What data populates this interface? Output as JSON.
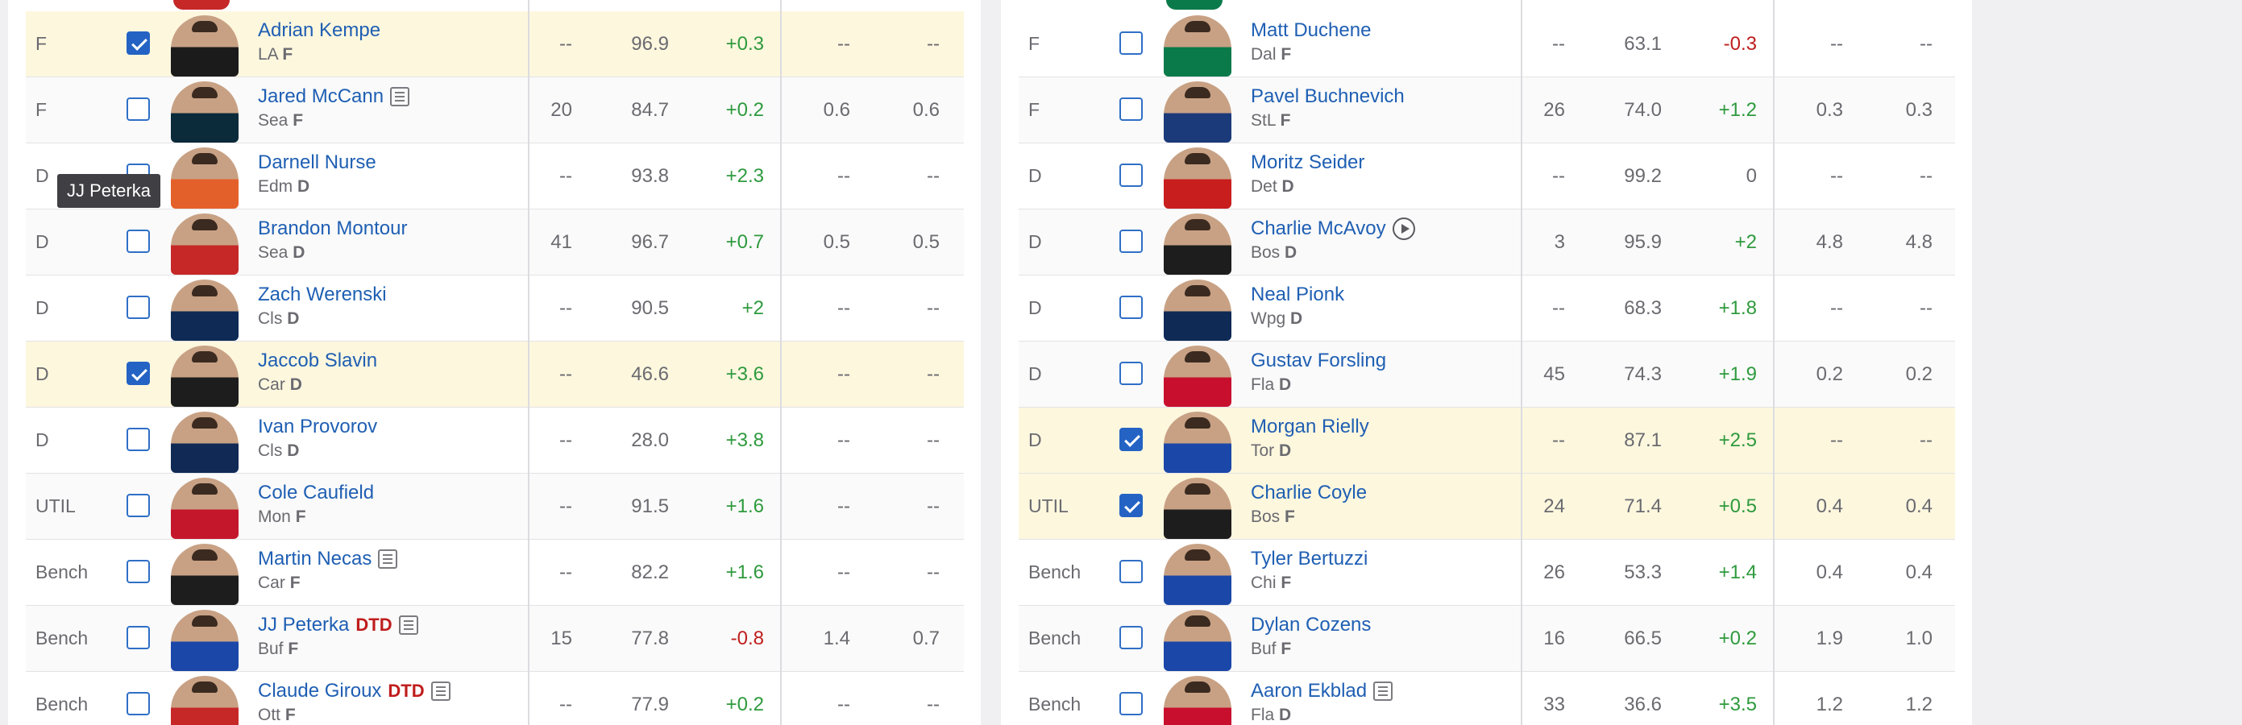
{
  "tooltip": "JJ Peterka",
  "left": {
    "rows": [
      {
        "pos": "F",
        "checked": true,
        "name": "Adrian Kempe",
        "team": "LA",
        "elig": "F",
        "dtd": "",
        "icon": "",
        "c1": "--",
        "c2": "96.9",
        "c3": "+0.3",
        "c4": "--",
        "c5": "--",
        "jersey": "#1b1b1b"
      },
      {
        "pos": "F",
        "checked": false,
        "name": "Jared McCann",
        "team": "Sea",
        "elig": "F",
        "dtd": "",
        "icon": "news-icon",
        "c1": "20",
        "c2": "84.7",
        "c3": "+0.2",
        "c4": "0.6",
        "c5": "0.6",
        "jersey": "#0b2a3a"
      },
      {
        "pos": "D",
        "checked": false,
        "name": "Darnell Nurse",
        "team": "Edm",
        "elig": "D",
        "dtd": "",
        "icon": "",
        "c1": "--",
        "c2": "93.8",
        "c3": "+2.3",
        "c4": "--",
        "c5": "--",
        "jersey": "#e4602a"
      },
      {
        "pos": "D",
        "checked": false,
        "name": "Brandon Montour",
        "team": "Sea",
        "elig": "D",
        "dtd": "",
        "icon": "",
        "c1": "41",
        "c2": "96.7",
        "c3": "+0.7",
        "c4": "0.5",
        "c5": "0.5",
        "jersey": "#c62828"
      },
      {
        "pos": "D",
        "checked": false,
        "name": "Zach Werenski",
        "team": "Cls",
        "elig": "D",
        "dtd": "",
        "icon": "",
        "c1": "--",
        "c2": "90.5",
        "c3": "+2",
        "c4": "--",
        "c5": "--",
        "jersey": "#0e2a55"
      },
      {
        "pos": "D",
        "checked": true,
        "name": "Jaccob Slavin",
        "team": "Car",
        "elig": "D",
        "dtd": "",
        "icon": "",
        "c1": "--",
        "c2": "46.6",
        "c3": "+3.6",
        "c4": "--",
        "c5": "--",
        "jersey": "#1d1d1d"
      },
      {
        "pos": "D",
        "checked": false,
        "name": "Ivan Provorov",
        "team": "Cls",
        "elig": "D",
        "dtd": "",
        "icon": "",
        "c1": "--",
        "c2": "28.0",
        "c3": "+3.8",
        "c4": "--",
        "c5": "--",
        "jersey": "#102a55"
      },
      {
        "pos": "UTIL",
        "checked": false,
        "name": "Cole Caufield",
        "team": "Mon",
        "elig": "F",
        "dtd": "",
        "icon": "",
        "c1": "--",
        "c2": "91.5",
        "c3": "+1.6",
        "c4": "--",
        "c5": "--",
        "jersey": "#c4172c"
      },
      {
        "pos": "Bench",
        "checked": false,
        "name": "Martin Necas",
        "team": "Car",
        "elig": "F",
        "dtd": "",
        "icon": "news-icon",
        "c1": "--",
        "c2": "82.2",
        "c3": "+1.6",
        "c4": "--",
        "c5": "--",
        "jersey": "#1d1d1d"
      },
      {
        "pos": "Bench",
        "checked": false,
        "name": "JJ Peterka",
        "team": "Buf",
        "elig": "F",
        "dtd": "DTD",
        "icon": "news-icon",
        "c1": "15",
        "c2": "77.8",
        "c3": "-0.8",
        "c4": "1.4",
        "c5": "0.7",
        "jersey": "#1a47a8"
      },
      {
        "pos": "Bench",
        "checked": false,
        "name": "Claude Giroux",
        "team": "Ott",
        "elig": "F",
        "dtd": "DTD",
        "icon": "news-icon",
        "c1": "--",
        "c2": "77.9",
        "c3": "+0.2",
        "c4": "--",
        "c5": "--",
        "jersey": "#c62828"
      }
    ]
  },
  "right": {
    "rows": [
      {
        "pos": "F",
        "checked": false,
        "name": "Matt Duchene",
        "team": "Dal",
        "elig": "F",
        "dtd": "",
        "icon": "",
        "c1": "--",
        "c2": "63.1",
        "c3": "-0.3",
        "c4": "--",
        "c5": "--",
        "jersey": "#0a7a4a"
      },
      {
        "pos": "F",
        "checked": false,
        "name": "Pavel Buchnevich",
        "team": "StL",
        "elig": "F",
        "dtd": "",
        "icon": "",
        "c1": "26",
        "c2": "74.0",
        "c3": "+1.2",
        "c4": "0.3",
        "c5": "0.3",
        "jersey": "#1b3a7a"
      },
      {
        "pos": "D",
        "checked": false,
        "name": "Moritz Seider",
        "team": "Det",
        "elig": "D",
        "dtd": "",
        "icon": "",
        "c1": "--",
        "c2": "99.2",
        "c3": "0",
        "c4": "--",
        "c5": "--",
        "jersey": "#c81e1e"
      },
      {
        "pos": "D",
        "checked": false,
        "name": "Charlie McAvoy",
        "team": "Bos",
        "elig": "D",
        "dtd": "",
        "icon": "play-icon",
        "c1": "3",
        "c2": "95.9",
        "c3": "+2",
        "c4": "4.8",
        "c5": "4.8",
        "jersey": "#1d1d1d"
      },
      {
        "pos": "D",
        "checked": false,
        "name": "Neal Pionk",
        "team": "Wpg",
        "elig": "D",
        "dtd": "",
        "icon": "",
        "c1": "--",
        "c2": "68.3",
        "c3": "+1.8",
        "c4": "--",
        "c5": "--",
        "jersey": "#0e2a55"
      },
      {
        "pos": "D",
        "checked": false,
        "name": "Gustav Forsling",
        "team": "Fla",
        "elig": "D",
        "dtd": "",
        "icon": "",
        "c1": "45",
        "c2": "74.3",
        "c3": "+1.9",
        "c4": "0.2",
        "c5": "0.2",
        "jersey": "#c8102e"
      },
      {
        "pos": "D",
        "checked": true,
        "name": "Morgan Rielly",
        "team": "Tor",
        "elig": "D",
        "dtd": "",
        "icon": "",
        "c1": "--",
        "c2": "87.1",
        "c3": "+2.5",
        "c4": "--",
        "c5": "--",
        "jersey": "#1b47a8"
      },
      {
        "pos": "UTIL",
        "checked": true,
        "name": "Charlie Coyle",
        "team": "Bos",
        "elig": "F",
        "dtd": "",
        "icon": "",
        "c1": "24",
        "c2": "71.4",
        "c3": "+0.5",
        "c4": "0.4",
        "c5": "0.4",
        "jersey": "#1d1d1d"
      },
      {
        "pos": "Bench",
        "checked": false,
        "name": "Tyler Bertuzzi",
        "team": "Chi",
        "elig": "F",
        "dtd": "",
        "icon": "",
        "c1": "26",
        "c2": "53.3",
        "c3": "+1.4",
        "c4": "0.4",
        "c5": "0.4",
        "jersey": "#1b47a8"
      },
      {
        "pos": "Bench",
        "checked": false,
        "name": "Dylan Cozens",
        "team": "Buf",
        "elig": "F",
        "dtd": "",
        "icon": "",
        "c1": "16",
        "c2": "66.5",
        "c3": "+0.2",
        "c4": "1.9",
        "c5": "1.0",
        "jersey": "#1a47a8"
      },
      {
        "pos": "Bench",
        "checked": false,
        "name": "Aaron Ekblad",
        "team": "Fla",
        "elig": "D",
        "dtd": "",
        "icon": "news-icon",
        "c1": "33",
        "c2": "36.6",
        "c3": "+3.5",
        "c4": "1.2",
        "c5": "1.2",
        "jersey": "#c8102e"
      }
    ]
  }
}
